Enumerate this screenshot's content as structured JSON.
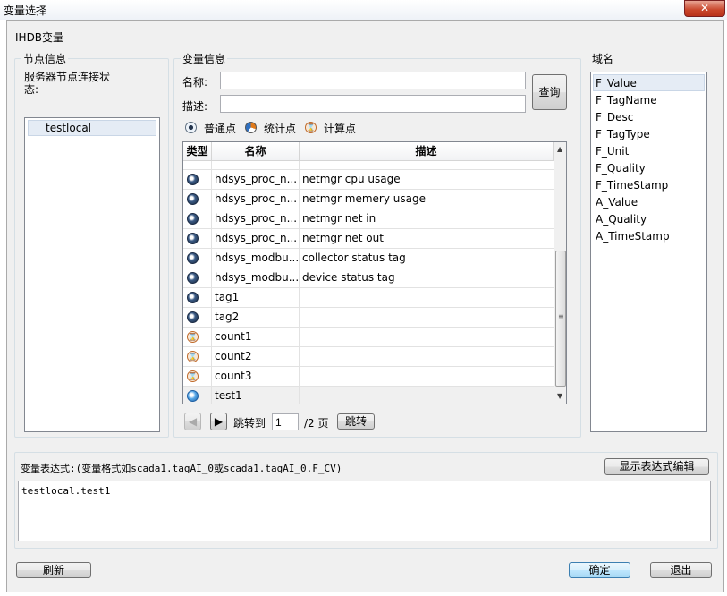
{
  "window": {
    "title": "变量选择",
    "close_glyph": "✕"
  },
  "db_label": "IHDB变量",
  "node_panel": {
    "title": "节点信息",
    "status_label": "服务器节点连接状态:",
    "nodes": [
      "testlocal"
    ]
  },
  "var_panel": {
    "title": "变量信息",
    "name_label": "名称:",
    "name_value": "",
    "desc_label": "描述:",
    "desc_value": "",
    "query_button": "查询",
    "filters": [
      {
        "label": "普通点",
        "icon": "normal-point-icon"
      },
      {
        "label": "统计点",
        "icon": "stat-point-icon"
      },
      {
        "label": "计算点",
        "icon": "calc-point-icon"
      }
    ],
    "columns": [
      "类型",
      "名称",
      "描述"
    ],
    "rows": [
      {
        "type": "normal",
        "name": "hdsys_proc_n...",
        "desc": "netmgr cpu usage"
      },
      {
        "type": "normal",
        "name": "hdsys_proc_n...",
        "desc": "netmgr memery usage"
      },
      {
        "type": "normal",
        "name": "hdsys_proc_n...",
        "desc": "netmgr net in"
      },
      {
        "type": "normal",
        "name": "hdsys_proc_n...",
        "desc": "netmgr net out"
      },
      {
        "type": "normal",
        "name": "hdsys_modbu...",
        "desc": "collector status tag"
      },
      {
        "type": "normal",
        "name": "hdsys_modbu...",
        "desc": "device status tag"
      },
      {
        "type": "normal",
        "name": "tag1",
        "desc": ""
      },
      {
        "type": "normal",
        "name": "tag2",
        "desc": ""
      },
      {
        "type": "calc",
        "name": "count1",
        "desc": ""
      },
      {
        "type": "calc",
        "name": "count2",
        "desc": ""
      },
      {
        "type": "calc",
        "name": "count3",
        "desc": ""
      },
      {
        "type": "selected",
        "name": "test1",
        "desc": ""
      }
    ],
    "pager": {
      "jump_label": "跳转到",
      "page_value": "1",
      "total": "/2 页",
      "jump_button": "跳转"
    }
  },
  "field_panel": {
    "title": "域名",
    "fields": [
      "F_Value",
      "F_TagName",
      "F_Desc",
      "F_TagType",
      "F_Unit",
      "F_Quality",
      "F_TimeStamp",
      "A_Value",
      "A_Quality",
      "A_TimeStamp"
    ]
  },
  "expression": {
    "label": "变量表达式:(变量格式如scada1.tagAI_0或scada1.tagAI_0.F_CV)",
    "editor_button": "显示表达式编辑",
    "value": "testlocal.test1"
  },
  "buttons": {
    "refresh": "刷新",
    "ok": "确定",
    "exit": "退出"
  }
}
